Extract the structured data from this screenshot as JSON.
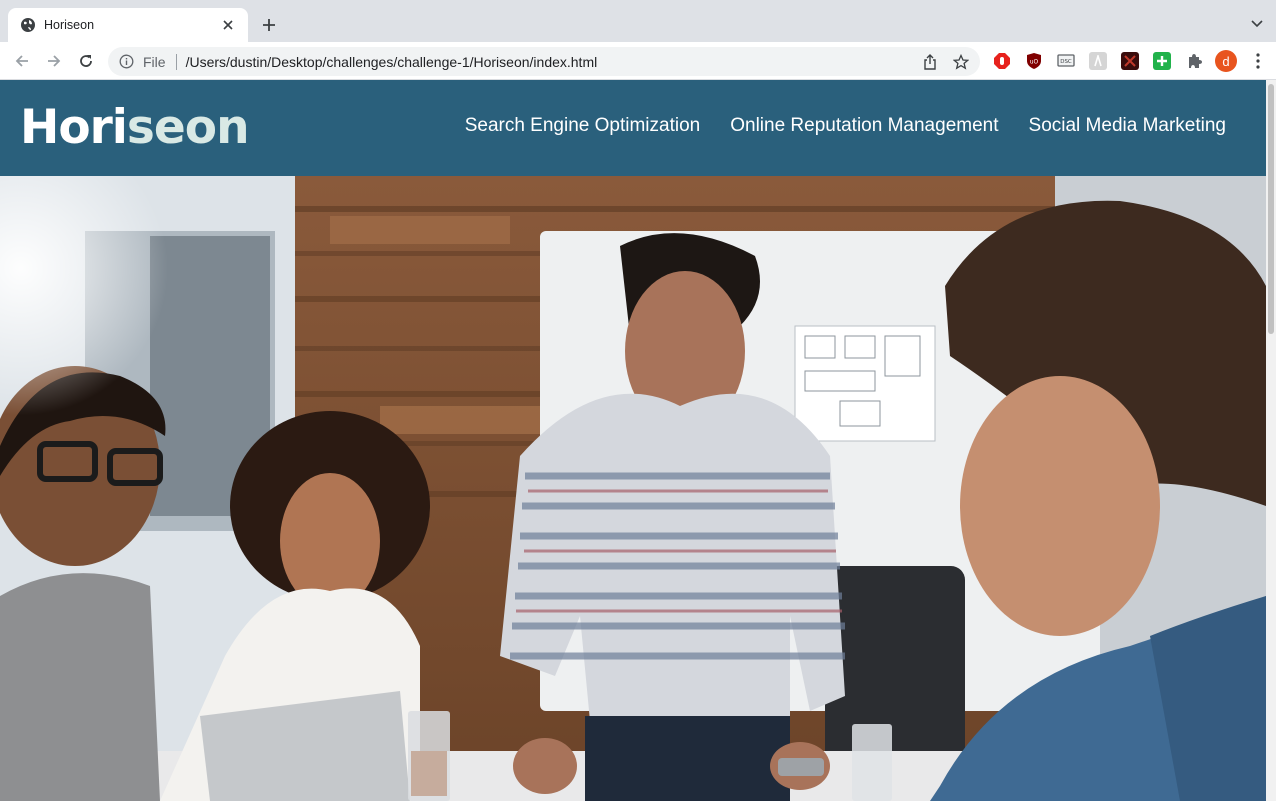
{
  "browser": {
    "tab": {
      "title": "Horiseon",
      "favicon": "globe-icon"
    },
    "new_tab_icon": "plus-icon",
    "omnibox": {
      "scheme_label": "File",
      "url": "/Users/dustin/Desktop/challenges/challenge-1/Horiseon/index.html"
    },
    "profile_initial": "d",
    "extensions": [
      "adblock-icon",
      "ublock-origin-icon",
      "dsc-extension-icon",
      "grammar-extension-icon",
      "dark-extension-icon",
      "green-plus-extension-icon",
      "puzzle-piece-icon"
    ]
  },
  "site": {
    "logo": {
      "part1": "Hori",
      "part2": "seon"
    },
    "nav": [
      {
        "label": "Search Engine Optimization"
      },
      {
        "label": "Online Reputation Management"
      },
      {
        "label": "Social Media Marketing"
      }
    ],
    "colors": {
      "header": "#2a607c",
      "logo_accent": "#d9e9e5"
    },
    "hero": {
      "description": "photo of a business team gathered around a table with a laptop"
    }
  }
}
